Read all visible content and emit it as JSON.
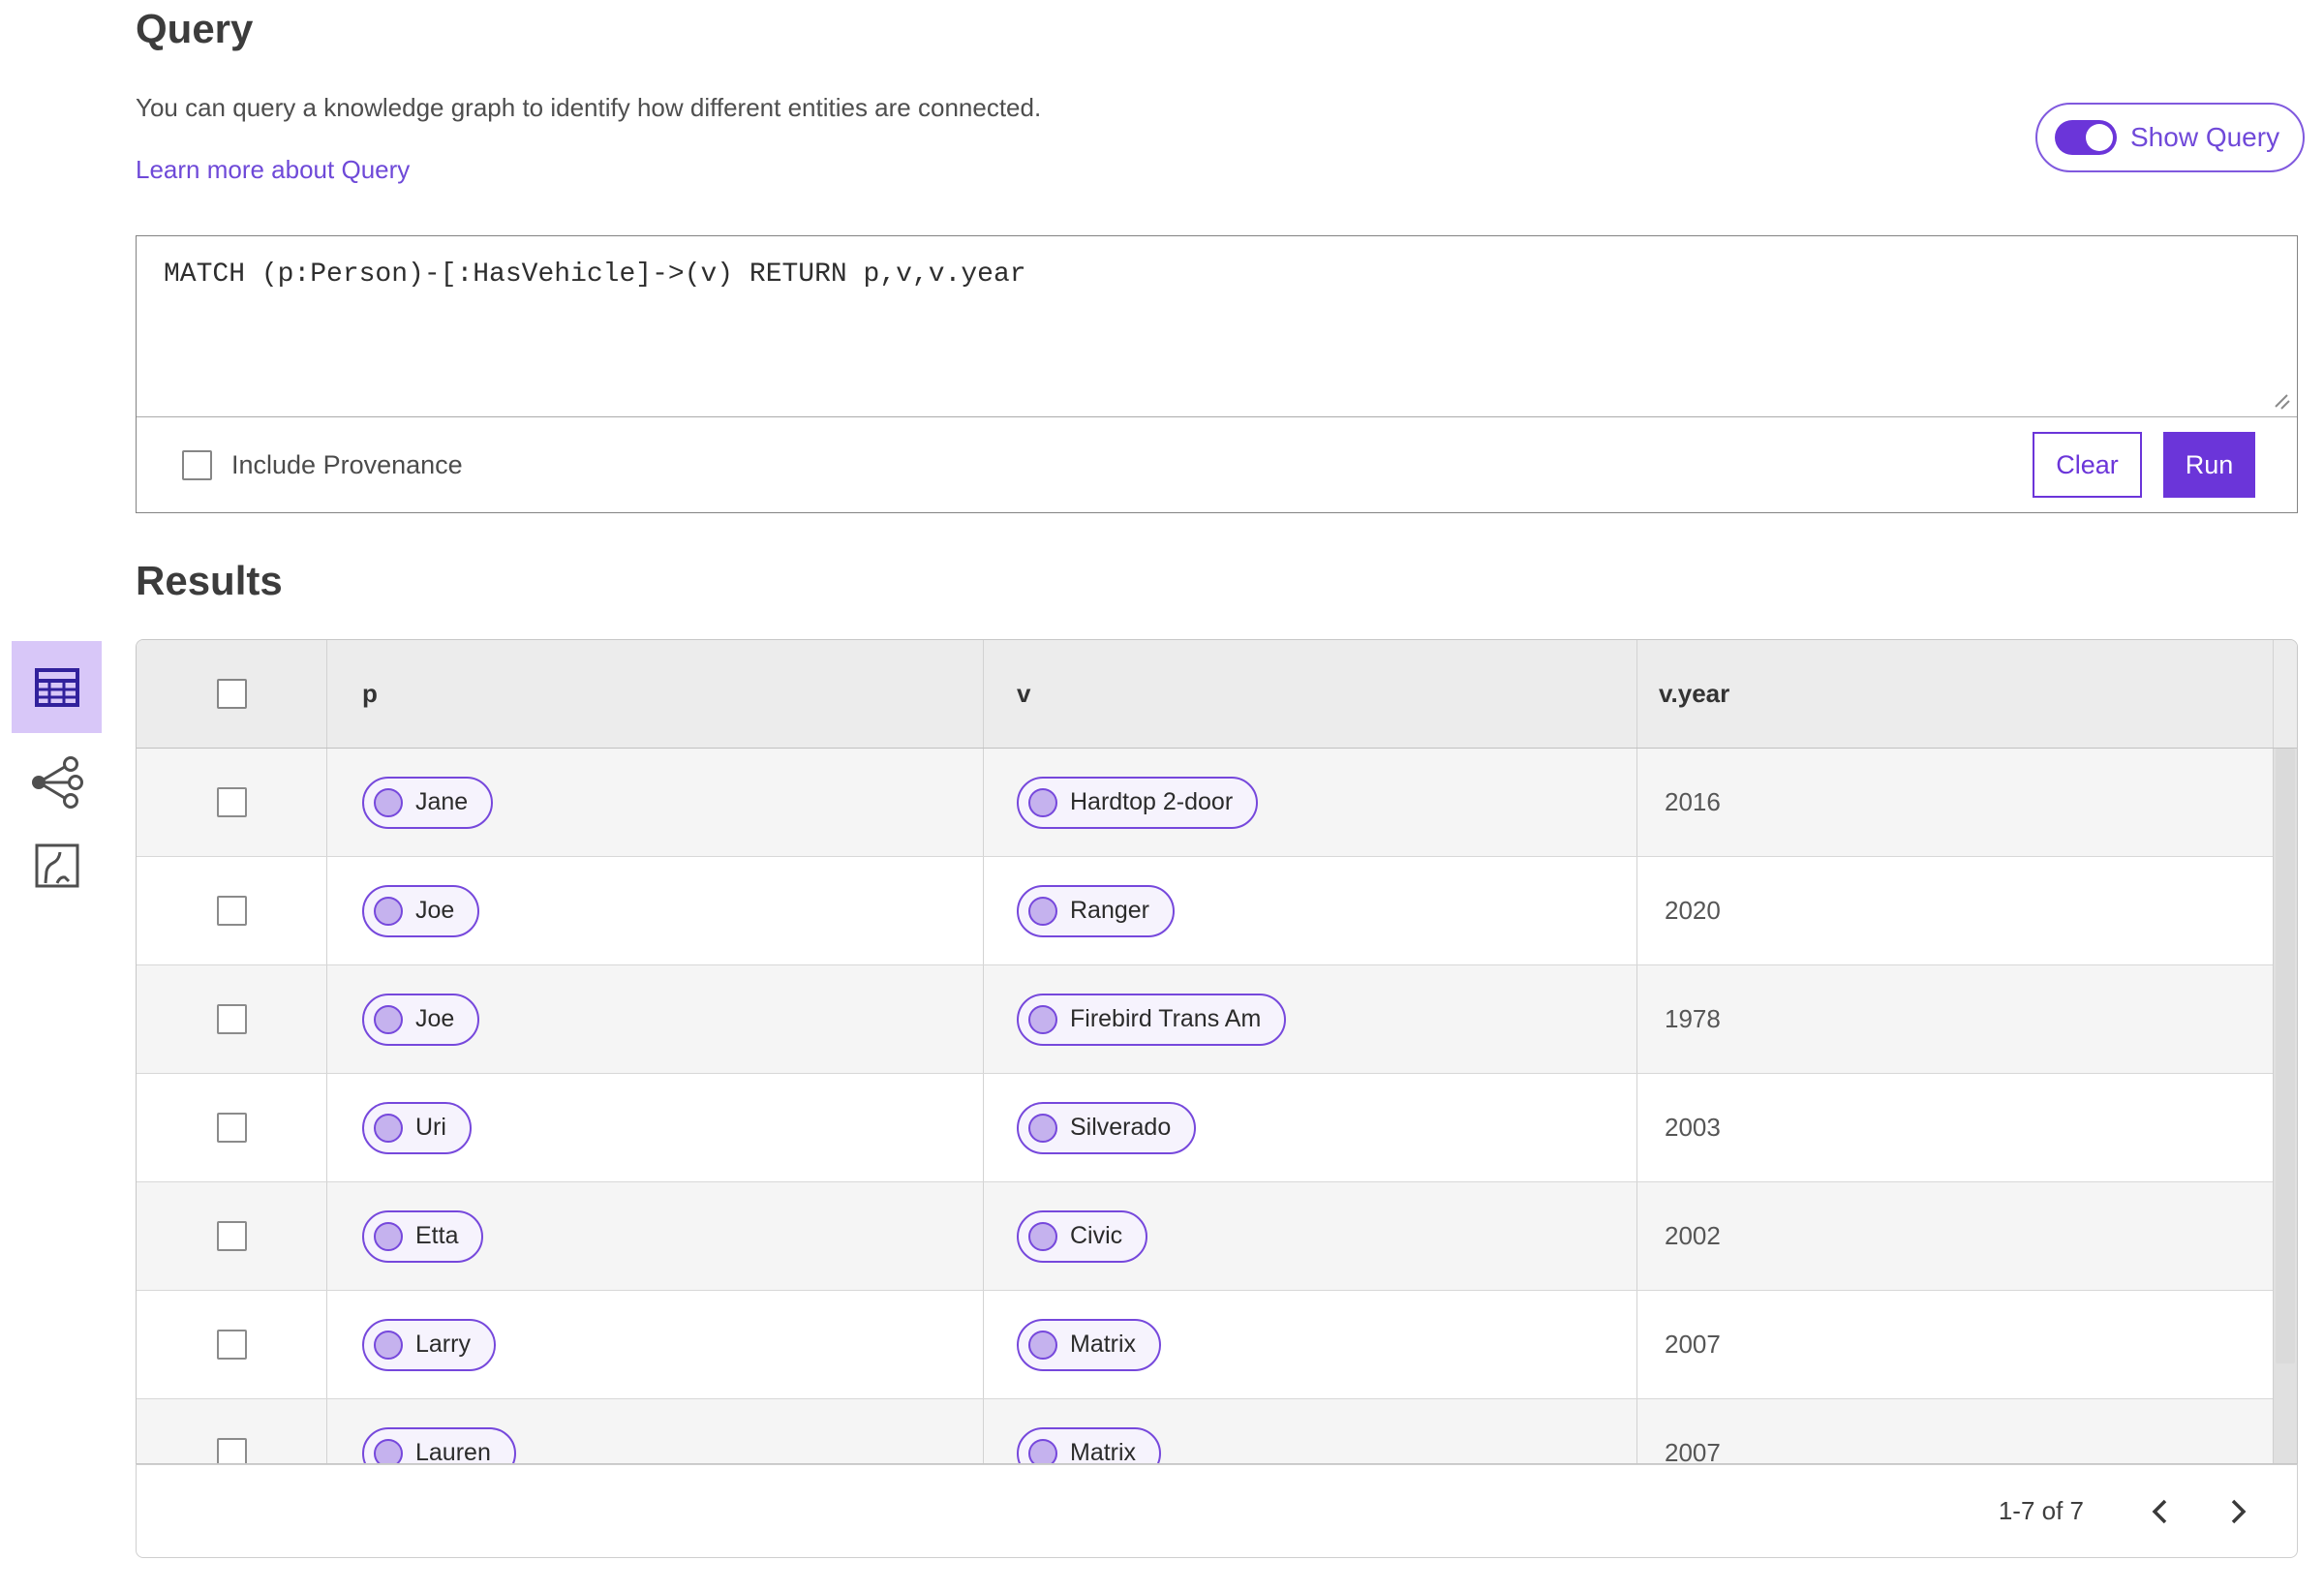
{
  "colors": {
    "accent": "#6b35d9",
    "link": "#6e49d8",
    "pill_border": "#7648dc",
    "pill_bg": "#f6f3fd",
    "pill_dot": "#c5b2ee",
    "selected_tile_bg": "#d8c7f8"
  },
  "page": {
    "title": "Query",
    "description": "You can query a knowledge graph to identify how different entities are connected.",
    "learn_more": "Learn more about Query",
    "show_query_label": "Show Query",
    "show_query_state": "on"
  },
  "query_editor": {
    "query": "MATCH (p:Person)-[:HasVehicle]->(v) RETURN p,v,v.year",
    "include_provenance_label": "Include Provenance",
    "include_provenance_checked": false,
    "clear_label": "Clear",
    "run_label": "Run"
  },
  "results": {
    "title": "Results",
    "views": [
      {
        "name": "table-view",
        "selected": true
      },
      {
        "name": "graph-view",
        "selected": false
      },
      {
        "name": "map-view",
        "selected": false
      }
    ],
    "table": {
      "columns": [
        "p",
        "v",
        "v.year"
      ],
      "rows": [
        {
          "p": "Jane",
          "v": "Hardtop 2-door",
          "year": "2016"
        },
        {
          "p": "Joe",
          "v": "Ranger",
          "year": "2020"
        },
        {
          "p": "Joe",
          "v": "Firebird Trans Am",
          "year": "1978"
        },
        {
          "p": "Uri",
          "v": "Silverado",
          "year": "2003"
        },
        {
          "p": "Etta",
          "v": "Civic",
          "year": "2002"
        },
        {
          "p": "Larry",
          "v": "Matrix",
          "year": "2007"
        },
        {
          "p": "Lauren",
          "v": "Matrix",
          "year": "2007"
        }
      ]
    },
    "pagination": {
      "range_label": "1-7 of 7"
    }
  }
}
